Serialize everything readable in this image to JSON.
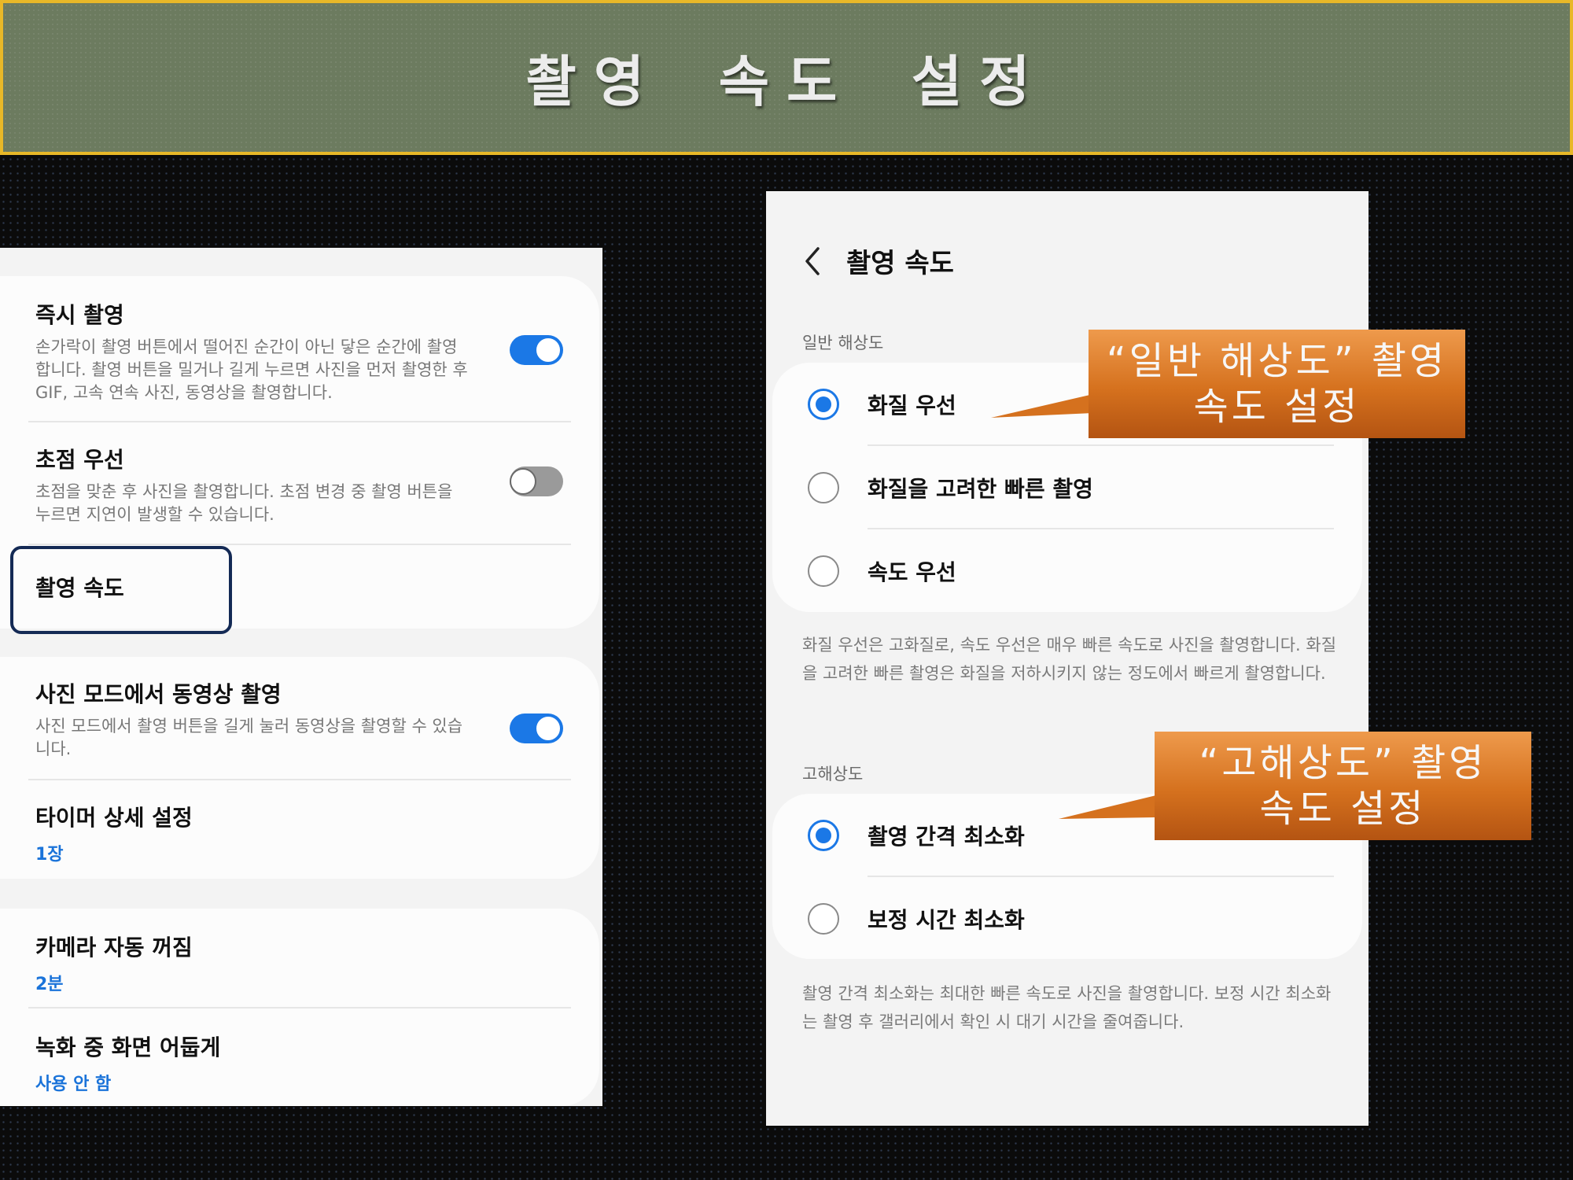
{
  "banner": {
    "title": "촬영 속도 설정"
  },
  "left_panel": {
    "instant_capture": {
      "title": "즉시 촬영",
      "desc": "손가락이 촬영 버튼에서 떨어진 순간이 아닌 닿은 순간에 촬영합니다. 촬영 버튼을 밀거나 길게 누르면 사진을 먼저 촬영한 후 GIF, 고속 연속 사진, 동영상을 촬영합니다.",
      "toggle_on": true
    },
    "focus_priority": {
      "title": "초점 우선",
      "desc": "초점을 맞춘 후 사진을 촬영합니다. 초점 변경 중 촬영 버튼을 누르면 지연이 발생할 수 있습니다.",
      "toggle_on": false
    },
    "shooting_speed": {
      "title": "촬영 속도"
    },
    "video_in_photo_mode": {
      "title": "사진 모드에서 동영상 촬영",
      "desc": "사진 모드에서 촬영 버튼을 길게 눌러 동영상을 촬영할 수 있습니다.",
      "toggle_on": true
    },
    "timer_detail": {
      "title": "타이머 상세 설정",
      "value": "1장"
    },
    "auto_off": {
      "title": "카메라 자동 꺼짐",
      "value": "2분"
    },
    "dim_screen": {
      "title": "녹화 중 화면 어둡게",
      "value": "사용 안 함"
    }
  },
  "right_panel": {
    "header_title": "촬영 속도",
    "normal_section_label": "일반 해상도",
    "normal_options": [
      {
        "label": "화질 우선",
        "selected": true
      },
      {
        "label": "화질을 고려한 빠른 촬영",
        "selected": false
      },
      {
        "label": "속도 우선",
        "selected": false
      }
    ],
    "normal_note": "화질 우선은 고화질로, 속도 우선은 매우 빠른 속도로 사진을 촬영합니다. 화질을 고려한 빠른 촬영은 화질을 저하시키지 않는 정도에서 빠르게 촬영합니다.",
    "high_section_label": "고해상도",
    "high_options": [
      {
        "label": "촬영 간격 최소화",
        "selected": true
      },
      {
        "label": "보정 시간 최소화",
        "selected": false
      }
    ],
    "high_note": "촬영 간격 최소화는 최대한 빠른 속도로 사진을 촬영합니다. 보정 시간 최소화는 촬영 후 갤러리에서 확인 시 대기 시간을 줄여줍니다."
  },
  "callouts": {
    "normal": {
      "line1": "“일반 해상도” 촬영",
      "line2": "속도 설정"
    },
    "high": {
      "line1": "“고해상도” 촬영",
      "line2": "속도 설정"
    }
  },
  "colors": {
    "accent": "#1b78e6",
    "banner_bg": "#6c7b5f",
    "banner_border": "#e8b828",
    "callout": "#d5711e"
  }
}
